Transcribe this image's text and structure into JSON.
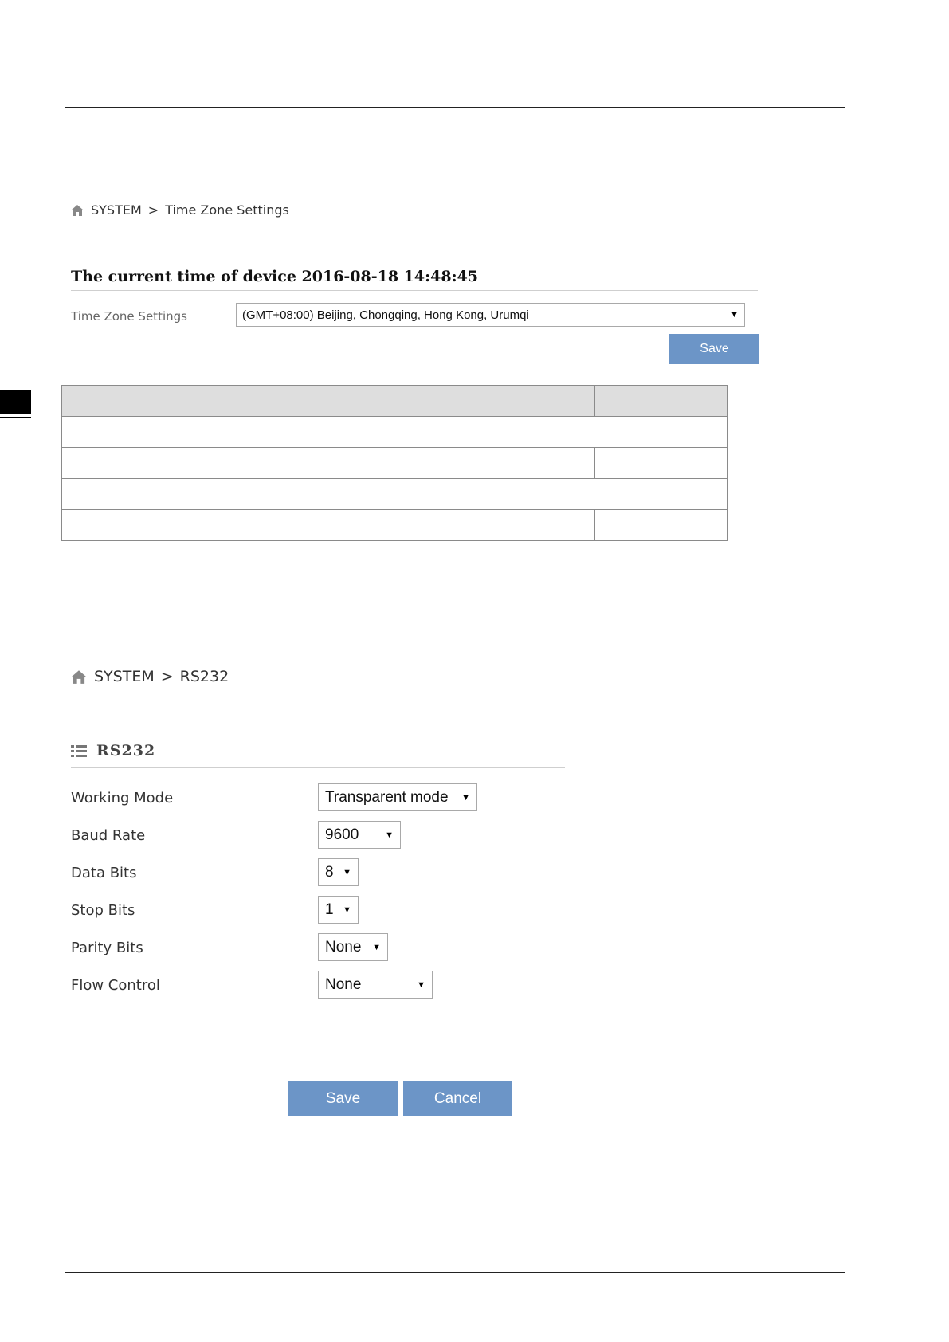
{
  "breadcrumb1": {
    "root": "SYSTEM",
    "sep": ">",
    "page": "Time Zone Settings"
  },
  "current_time": {
    "label": "The current time of device",
    "value": "2016-08-18 14:48:45"
  },
  "timezone": {
    "label": "Time Zone Settings",
    "selected": "(GMT+08:00) Beijing, Chongqing, Hong Kong, Urumqi",
    "save_label": "Save"
  },
  "breadcrumb2": {
    "root": "SYSTEM",
    "sep": ">",
    "page": "RS232"
  },
  "rs232": {
    "title": "RS232",
    "fields": [
      {
        "label": "Working Mode",
        "value": "Transparent mode"
      },
      {
        "label": "Baud Rate",
        "value": "9600"
      },
      {
        "label": "Data Bits",
        "value": "8"
      },
      {
        "label": "Stop Bits",
        "value": "1"
      },
      {
        "label": "Parity Bits",
        "value": "None"
      },
      {
        "label": "Flow Control",
        "value": "None"
      }
    ],
    "save_label": "Save",
    "cancel_label": "Cancel"
  },
  "icons": {
    "home": "home-icon",
    "list": "list-icon",
    "dropdown": "dropdown-arrow-icon"
  },
  "colors": {
    "button": "#6c95c7",
    "table_header": "#dedede"
  }
}
